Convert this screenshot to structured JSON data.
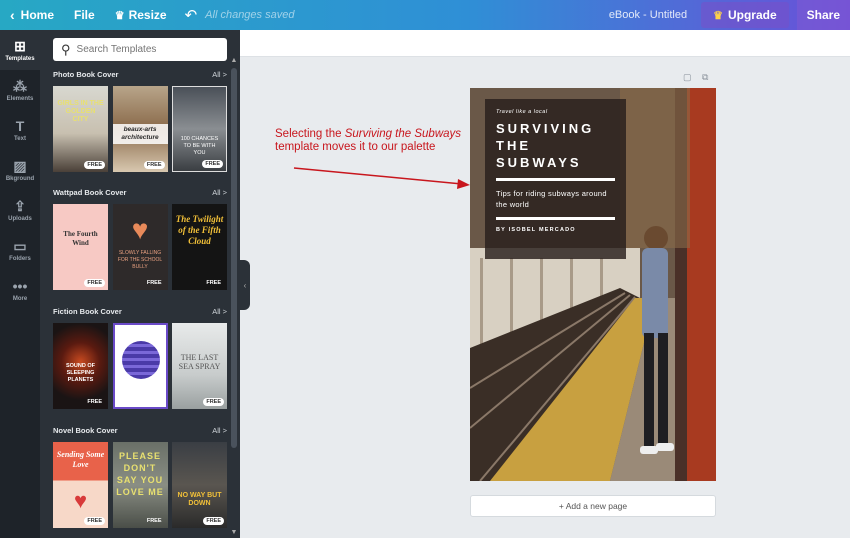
{
  "topbar": {
    "home": "Home",
    "file": "File",
    "resize": "Resize",
    "undo_icon": "undo-icon",
    "saved_status": "All changes saved",
    "document_title": "eBook - Untitled",
    "upgrade": "Upgrade",
    "share": "Share"
  },
  "rail": [
    {
      "label": "Templates",
      "icon": "templates-icon",
      "glyph": "⊞",
      "active": true
    },
    {
      "label": "Elements",
      "icon": "elements-icon",
      "glyph": "⁂",
      "active": false
    },
    {
      "label": "Text",
      "icon": "text-icon",
      "glyph": "T",
      "active": false
    },
    {
      "label": "Bkground",
      "icon": "background-icon",
      "glyph": "▨",
      "active": false
    },
    {
      "label": "Uploads",
      "icon": "upload-icon",
      "glyph": "⇪",
      "active": false
    },
    {
      "label": "Folders",
      "icon": "folder-icon",
      "glyph": "▭",
      "active": false
    },
    {
      "label": "More",
      "icon": "more-icon",
      "glyph": "•••",
      "active": false
    }
  ],
  "search": {
    "placeholder": "Search Templates"
  },
  "sections": [
    {
      "title": "Photo Book Cover",
      "all": "All  >",
      "thumbs": [
        {
          "text": "GIRLS IN THE GOLDEN CITY",
          "free": "FREE"
        },
        {
          "text": "beaux-arts architecture",
          "free": "FREE"
        },
        {
          "text": "100 CHANCES TO BE WITH YOU",
          "free": "FREE"
        }
      ]
    },
    {
      "title": "Wattpad Book Cover",
      "all": "All  >",
      "thumbs": [
        {
          "text": "The Fourth Wind",
          "free": "FREE"
        },
        {
          "text": "SLOWLY FALLING FOR THE SCHOOL BULLY",
          "free": "FREE"
        },
        {
          "text": "The Twilight of the Fifth Cloud",
          "free": "FREE"
        }
      ]
    },
    {
      "title": "Fiction Book Cover",
      "all": "All  >",
      "thumbs": [
        {
          "text": "SOUND OF SLEEPING PLANETS",
          "free": "FREE"
        },
        {
          "text": "",
          "free": ""
        },
        {
          "text": "THE LAST SEA SPRAY",
          "free": "FREE"
        }
      ]
    },
    {
      "title": "Novel Book Cover",
      "all": "All  >",
      "thumbs": [
        {
          "text": "Sending Some Love",
          "free": "FREE"
        },
        {
          "text": "PLEASE DON'T SAY YOU LOVE ME",
          "free": "FREE"
        },
        {
          "text": "NO WAY BUT DOWN",
          "free": "FREE"
        }
      ]
    }
  ],
  "annotation": {
    "prefix": "Selecting the ",
    "em": "Surviving the Subways",
    "suffix": " template moves it to our palette"
  },
  "cover": {
    "tagline": "Travel like a local",
    "title_lines": [
      "SURVIVING",
      "THE",
      "SUBWAYS"
    ],
    "subtitle": "Tips for riding subways around the world",
    "author": "BY ISOBEL MERCADO"
  },
  "add_page": "+ Add a new page",
  "colors": {
    "annotation": "#c8161d",
    "panel": "#2b3138",
    "rail": "#1e2329"
  }
}
